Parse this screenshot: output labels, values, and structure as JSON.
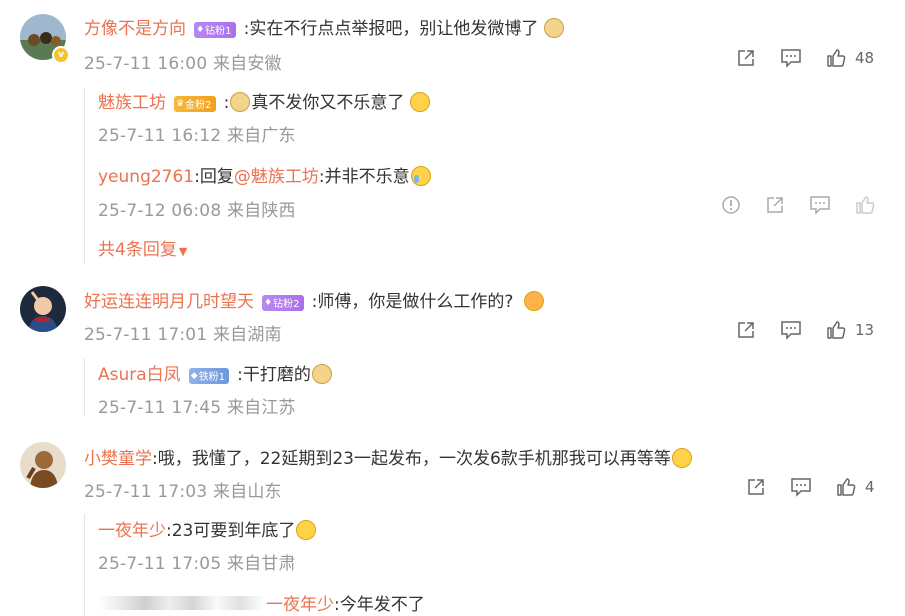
{
  "comments": [
    {
      "user": "方像不是方向",
      "badge": "钻粉1",
      "text": ":实在不行点点举报吧，别让他发微博了",
      "time": "25-7-11 16:00",
      "location": "来自安徽",
      "likes": "48",
      "replies": [
        {
          "user": "魅族工坊",
          "badge": "金粉2",
          "text_before": ":",
          "text": "真不发你又不乐意了",
          "time": "25-7-11 16:12",
          "location": "来自广东"
        },
        {
          "user": "yeung2761",
          "text": ":回复",
          "mention": "@魅族工坊",
          "text_after": ":并非不乐意",
          "time": "25-7-12 06:08",
          "location": "来自陕西"
        }
      ],
      "more": "共4条回复"
    },
    {
      "user": "好运连连明月几时望天",
      "badge": "钻粉2",
      "text": ":师傅，你是做什么工作的?",
      "time": "25-7-11 17:01",
      "location": "来自湖南",
      "likes": "13",
      "replies": [
        {
          "user": "Asura白凤",
          "badge": "铁粉1",
          "text": ":干打磨的",
          "time": "25-7-11 17:45",
          "location": "来自江苏"
        }
      ]
    },
    {
      "user": "小樊童学",
      "text": ":哦，我懂了，22延期到23一起发布，一次发6款手机那我可以再等等",
      "time": "25-7-11 17:03",
      "location": "来自山东",
      "likes": "4",
      "replies": [
        {
          "user": "一夜年少",
          "text": ":23可要到年底了",
          "time": "25-7-11 17:05",
          "location": "来自甘肃"
        },
        {
          "mention": "一夜年少",
          "text_after": ":今年发不了"
        }
      ]
    }
  ],
  "icons": {
    "share": "share-icon",
    "comment": "comment-icon",
    "like": "like-icon",
    "report": "report-icon"
  },
  "colors": {
    "username": "#eb7350",
    "meta": "#999999",
    "text": "#333333"
  }
}
